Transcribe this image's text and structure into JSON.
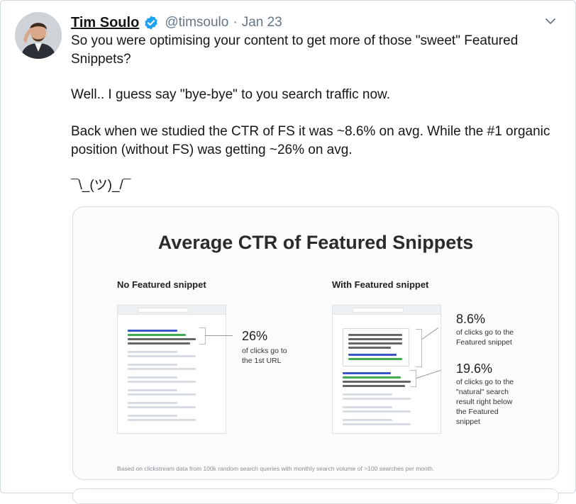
{
  "tweet": {
    "author_name": "Tim Soulo",
    "handle": "@timsoulo",
    "separator": "·",
    "date": "Jan 23",
    "paragraphs": [
      "So you were optimising your content to get more of those \"sweet\" Featured Snippets?",
      "Well.. I guess say \"bye-bye\" to you search traffic now.",
      "Back when we studied the CTR of FS it was ~8.6% on avg. While the #1 organic position (without FS) was getting ~26% on avg.",
      "¯\\_(ツ)_/¯"
    ]
  },
  "card": {
    "title": "Average CTR of Featured Snippets",
    "left_label": "No Featured snippet",
    "right_label": "With Featured snippet",
    "left_pct": "26%",
    "left_desc": "of clicks go to the 1st URL",
    "right_pct_1": "8.6%",
    "right_desc_1": "of clicks go to the Featured snippet",
    "right_pct_2": "19.6%",
    "right_desc_2": "of clicks go to the \"natural\" search result right below the Featured snippet",
    "footnote": "Based on clickstream data from 100k random search queries with monthly search volume of >100 searches per month."
  },
  "colors": {
    "verified": "#1da1f2",
    "link_blue": "#3a56c8",
    "snippet_green": "#3fae4f"
  },
  "icons": {
    "verified": "verified-badge-icon",
    "menu": "chevron-down-icon"
  }
}
